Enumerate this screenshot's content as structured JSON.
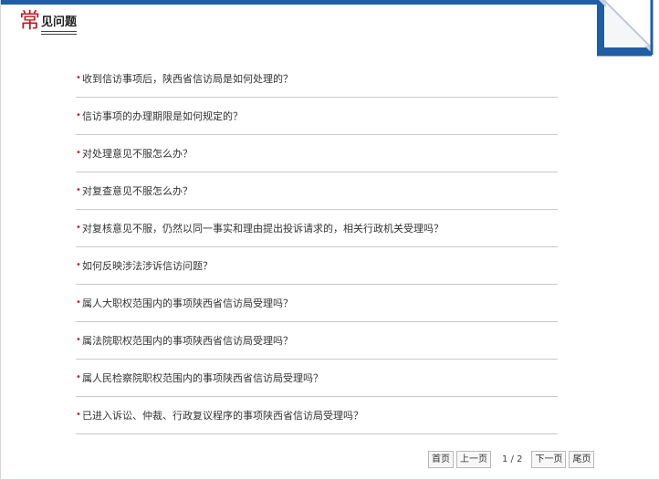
{
  "header": {
    "title_first": "常",
    "title_rest": "见问题"
  },
  "questions": [
    "收到信访事项后，陕西省信访局是如何处理的？",
    "信访事项的办理期限是如何规定的？",
    "对处理意见不服怎么办？",
    "对复查意见不服怎么办？",
    "对复核意见不服，仍然以同一事实和理由提出投诉请求的，相关行政机关受理吗？",
    "如何反映涉法涉诉信访问题？",
    "属人大职权范围内的事项陕西省信访局受理吗？",
    "属法院职权范围内的事项陕西省信访局受理吗？",
    "属人民检察院职权范围内的事项陕西省信访局受理吗？",
    "已进入诉讼、仲裁、行政复议程序的事项陕西省信访局受理吗？"
  ],
  "bullet": "•",
  "pager": {
    "first": "首页",
    "prev": "上一页",
    "info": "1 / 2",
    "next": "下一页",
    "last": "尾页"
  },
  "colors": {
    "accent_blue": "#1f5da6",
    "title_red": "#c0151b",
    "bullet_red": "#d0202a"
  }
}
